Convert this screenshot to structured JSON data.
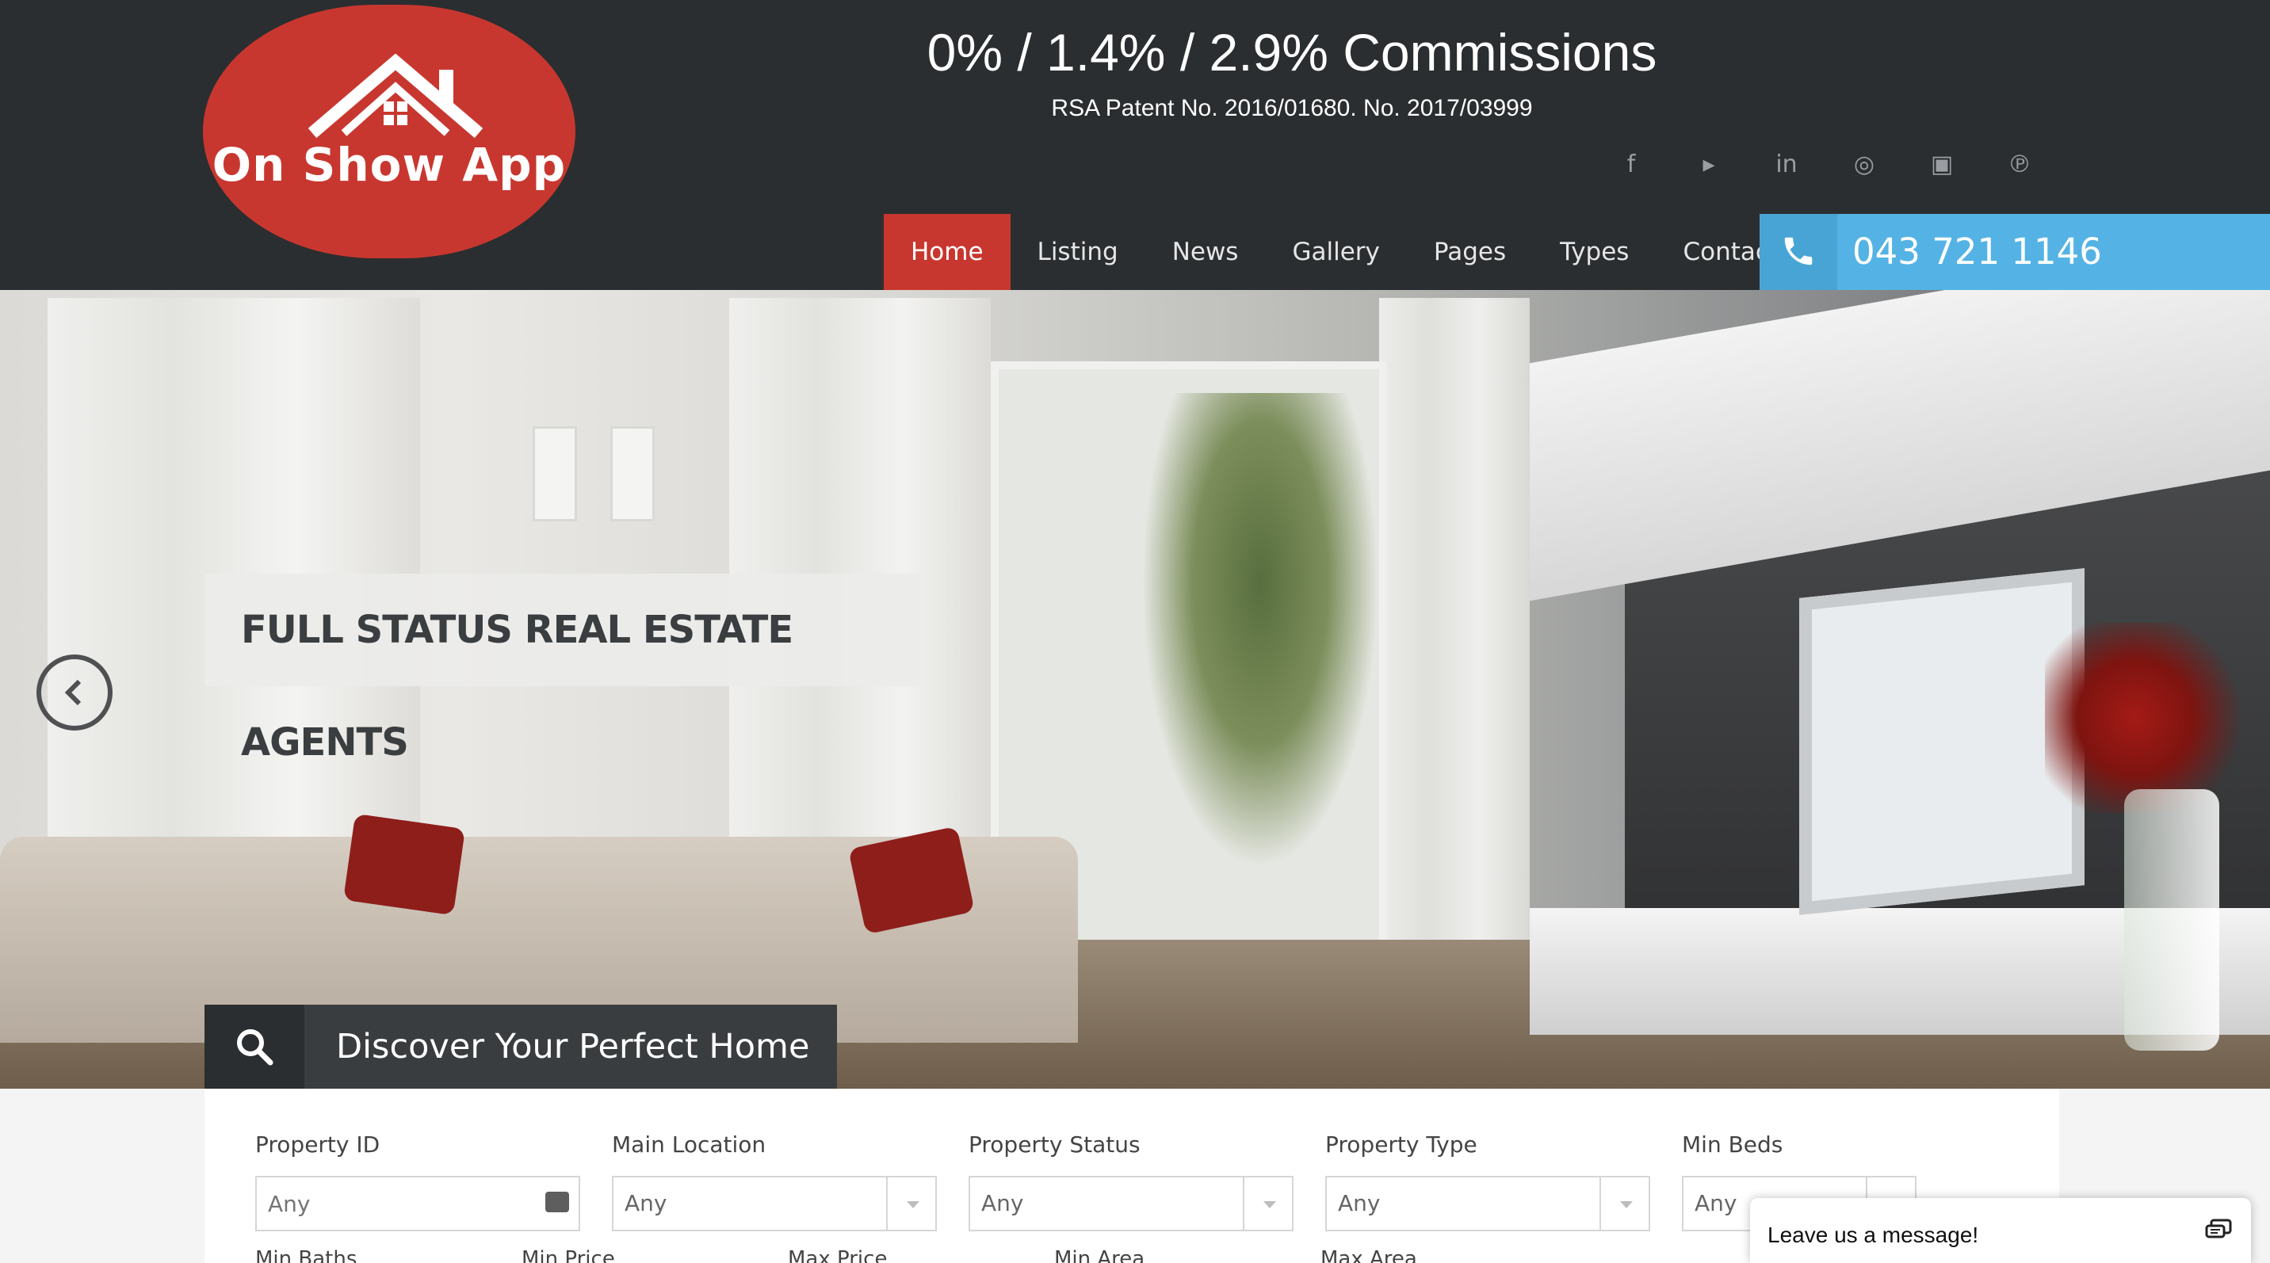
{
  "header": {
    "logo_text": "On Show App",
    "headline": "0% / 1.4% / 2.9% Commissions",
    "patent": "RSA Patent No. 2016/01680. No. 2017/03999",
    "social_icons": [
      "facebook-icon",
      "twitter-icon",
      "linkedin-icon",
      "instagram-icon",
      "youtube-icon",
      "pinterest-icon"
    ],
    "social_glyphs": [
      "f",
      "▸",
      "in",
      "◎",
      "▣",
      "℗"
    ]
  },
  "nav": {
    "items": [
      "Home",
      "Listing",
      "News",
      "Gallery",
      "Pages",
      "Types",
      "Contact us"
    ],
    "active": "Home",
    "phone": "043 721 1146"
  },
  "hero": {
    "tagline": "FULL STATUS REAL ESTATE AGENTS",
    "discover_title": "Discover Your Perfect Home"
  },
  "search": {
    "fields": [
      {
        "label": "Property ID",
        "value": "Any"
      },
      {
        "label": "Main Location",
        "value": "Any"
      },
      {
        "label": "Property Status",
        "value": "Any"
      },
      {
        "label": "Property Type",
        "value": "Any"
      },
      {
        "label": "Min Beds",
        "value": "Any"
      }
    ],
    "second_row": [
      "Min Baths",
      "Min Price",
      "Max Price",
      "Min Area",
      "Max Area"
    ]
  },
  "chat": {
    "label": "Leave us a message!"
  },
  "colors": {
    "header_bg": "#2b2e30",
    "brand_red": "#c8372f",
    "phone_blue": "#54b3e4"
  }
}
